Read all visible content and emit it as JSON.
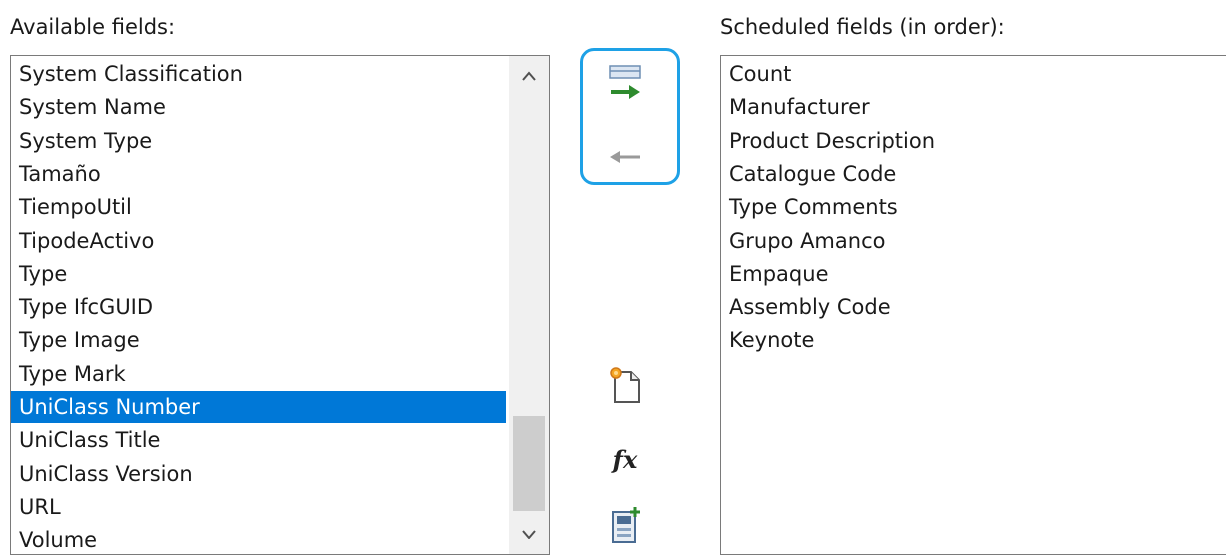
{
  "available": {
    "label": "Available fields:",
    "items": [
      {
        "text": "System Classification",
        "selected": false
      },
      {
        "text": "System Name",
        "selected": false
      },
      {
        "text": "System Type",
        "selected": false
      },
      {
        "text": "Tamaño",
        "selected": false
      },
      {
        "text": "TiempoUtil",
        "selected": false
      },
      {
        "text": "TipodeActivo",
        "selected": false
      },
      {
        "text": "Type",
        "selected": false
      },
      {
        "text": "Type IfcGUID",
        "selected": false
      },
      {
        "text": "Type Image",
        "selected": false
      },
      {
        "text": "Type Mark",
        "selected": false
      },
      {
        "text": "UniClass Number",
        "selected": true
      },
      {
        "text": "UniClass Title",
        "selected": false
      },
      {
        "text": "UniClass Version",
        "selected": false
      },
      {
        "text": "URL",
        "selected": false
      },
      {
        "text": "Volume",
        "selected": false
      }
    ]
  },
  "scheduled": {
    "label": "Scheduled fields (in order):",
    "items": [
      "Count",
      "Manufacturer",
      "Product Description",
      "Catalogue Code",
      "Type Comments",
      "Grupo  Amanco",
      "Empaque",
      "Assembly Code",
      "Keynote"
    ]
  },
  "buttons": {
    "add": {
      "icon": "add-parameter-icon"
    },
    "remove": {
      "icon": "remove-parameter-icon"
    },
    "new_parameter": {
      "icon": "new-parameter-icon"
    },
    "formula": {
      "icon": "formula-icon",
      "glyph": "fx"
    },
    "combine": {
      "icon": "combine-parameters-icon"
    }
  },
  "colors": {
    "selection": "#0078d7",
    "focus_ring": "#1ea1e6",
    "arrow_green": "#2e8b2e",
    "arrow_gray": "#9a9a9a"
  }
}
